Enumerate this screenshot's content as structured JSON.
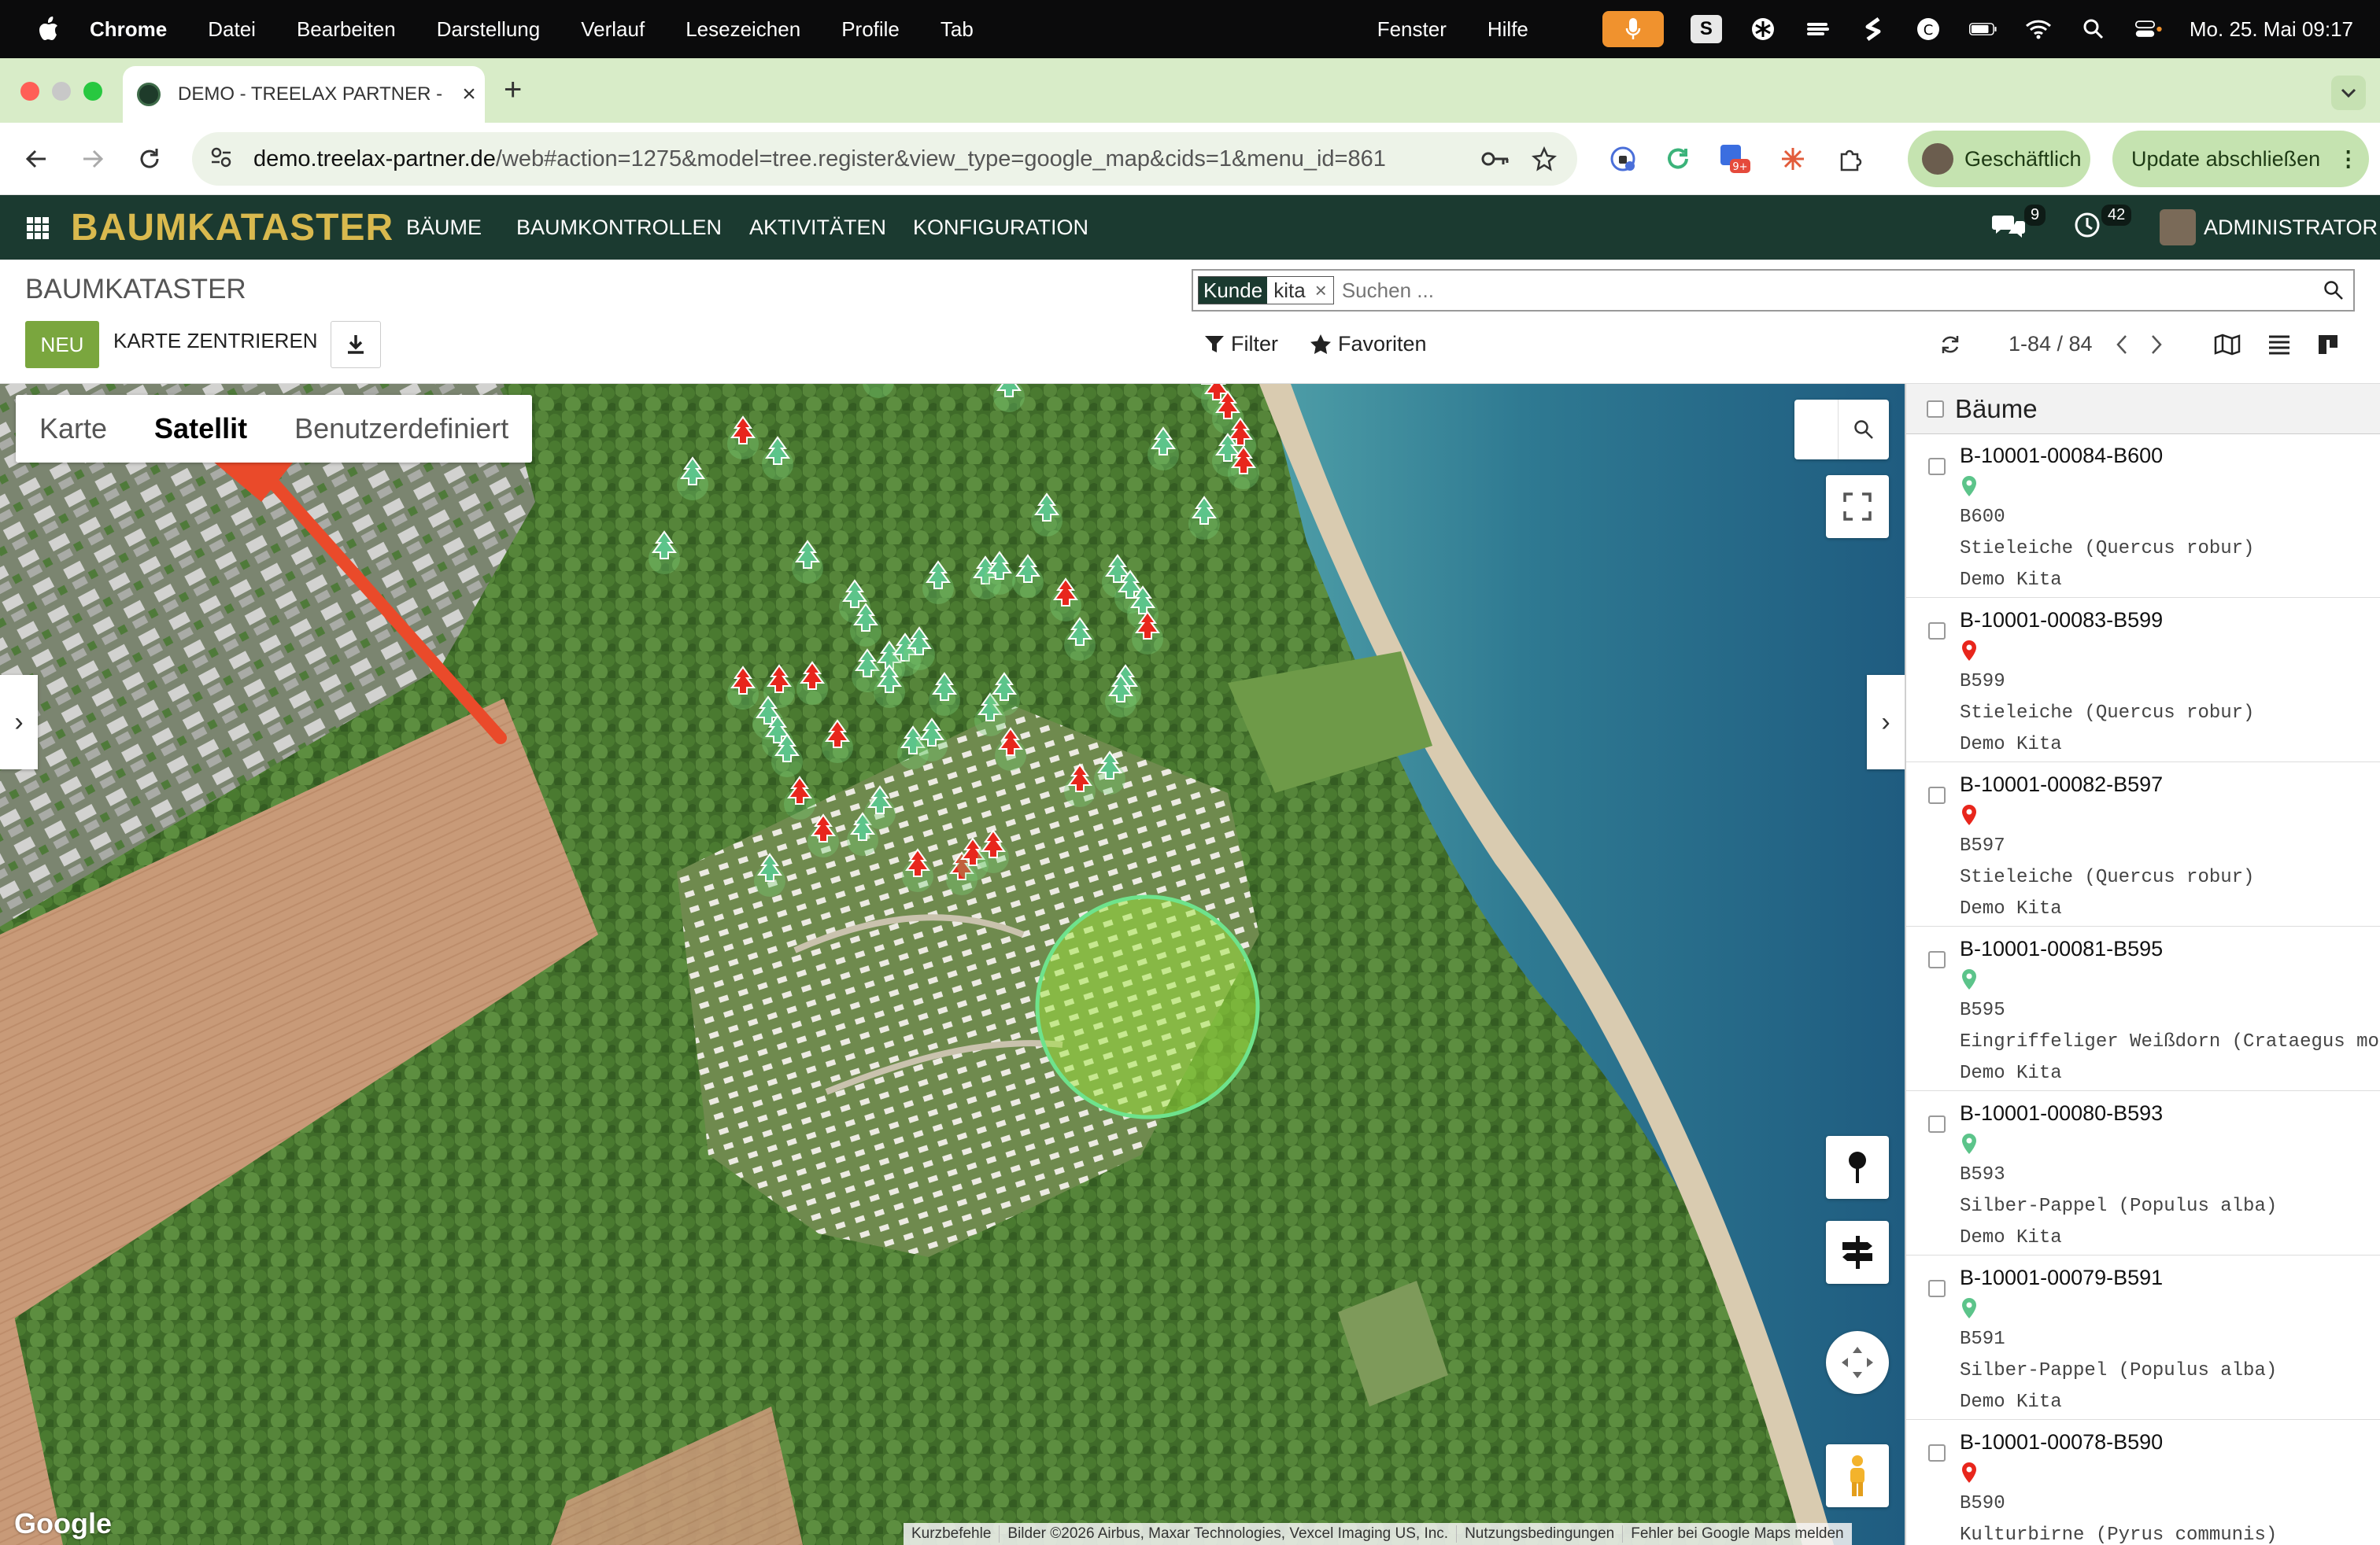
{
  "menubar": {
    "app": "Chrome",
    "items": [
      "Datei",
      "Bearbeiten",
      "Darstellung",
      "Verlauf",
      "Lesezeichen",
      "Profile",
      "Tab"
    ],
    "right_items": [
      "Fenster",
      "Hilfe"
    ],
    "s_badge": "S",
    "clock": "Mo. 25. Mai  09:17"
  },
  "browser": {
    "tab_title": "DEMO - TREELAX PARTNER -",
    "url_host": "demo.treelax-partner.de",
    "url_path": "/web#action=1275&model=tree.register&view_type=google_map&cids=1&menu_id=861",
    "ext_badge": "9+",
    "profile_label": "Geschäftlich",
    "update_label": "Update abschließen"
  },
  "app": {
    "brand": "BAUMKATASTER",
    "menu": [
      "BÄUME",
      "BAUMKONTROLLEN",
      "AKTIVITÄTEN",
      "KONFIGURATION"
    ],
    "messages_count": "9",
    "activities_count": "42",
    "user": "ADMINISTRATOR"
  },
  "control_panel": {
    "breadcrumb": "BAUMKATASTER",
    "new_label": "NEU",
    "center_label": "KARTE ZENTRIEREN",
    "facet_key": "Kunde",
    "facet_value": "kita",
    "search_placeholder": "Suchen ...",
    "filter_label": "Filter",
    "favorites_label": "Favoriten",
    "pager": "1-84 / 84"
  },
  "map": {
    "type_tabs": [
      "Karte",
      "Satellit",
      "Benutzerdefiniert"
    ],
    "active_type": "Satellit",
    "google_logo": "Google",
    "attribution": [
      "Kurzbefehle",
      "Bilder ©2026 Airbus, Maxar Technologies, Vexcel Imaging US, Inc.",
      "Nutzungsbedingungen",
      "Fehler bei Google Maps melden"
    ]
  },
  "list": {
    "header": "Bäume",
    "records": [
      {
        "id": "B-10001-00084-B600",
        "code": "B600",
        "species": "Stieleiche (Quercus robur)",
        "customer": "Demo Kita",
        "status": "green"
      },
      {
        "id": "B-10001-00083-B599",
        "code": "B599",
        "species": "Stieleiche (Quercus robur)",
        "customer": "Demo Kita",
        "status": "red"
      },
      {
        "id": "B-10001-00082-B597",
        "code": "B597",
        "species": "Stieleiche (Quercus robur)",
        "customer": "Demo Kita",
        "status": "red"
      },
      {
        "id": "B-10001-00081-B595",
        "code": "B595",
        "species": "Eingriffeliger Weißdorn (Crataegus monog",
        "customer": "Demo Kita",
        "status": "green"
      },
      {
        "id": "B-10001-00080-B593",
        "code": "B593",
        "species": "Silber-Pappel (Populus alba)",
        "customer": "Demo Kita",
        "status": "green"
      },
      {
        "id": "B-10001-00079-B591",
        "code": "B591",
        "species": "Silber-Pappel (Populus alba)",
        "customer": "Demo Kita",
        "status": "green"
      },
      {
        "id": "B-10001-00078-B590",
        "code": "B590",
        "species": "Kulturbirne (Pyrus communis)",
        "customer": "",
        "status": "red"
      }
    ]
  },
  "colors": {
    "brand_gold": "#d9b94e",
    "navbar": "#1b3a30",
    "tree_ok": "#5cc48a",
    "tree_alert": "#e8261c",
    "new_button": "#7aa63e"
  }
}
